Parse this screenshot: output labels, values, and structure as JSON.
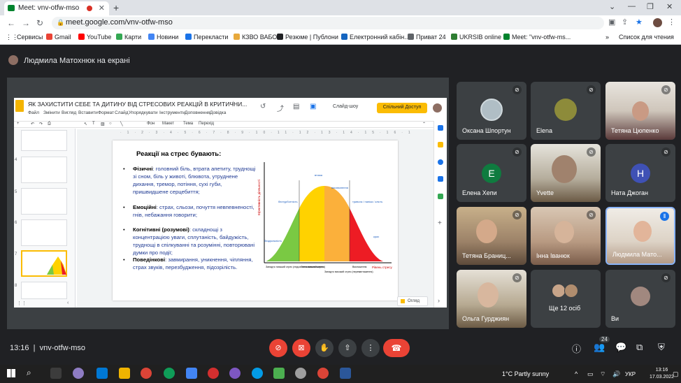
{
  "browser": {
    "tab_title": "Meet: vnv-otfw-mso",
    "url": "meet.google.com/vnv-otfw-mso",
    "bookmarks": [
      "Сервисы",
      "Gmail",
      "YouTube",
      "Карти",
      "Новини",
      "Перекласти",
      "КЗВО ВАБО",
      "Резюме | Публони",
      "Електронний кабін...",
      "Приват 24",
      "UKRSIB online",
      "Meet: \"vnv-otfw-ms..."
    ],
    "reading_list": "Список для чтения",
    "bookmark_colors": [
      "#4285f4",
      "#ea4335",
      "#ff0000",
      "#34a853",
      "#4285f4",
      "#1a73e8",
      "#e8a93c",
      "#202124",
      "#1565c0",
      "#5f6368",
      "#2e7d32",
      "#00832d"
    ]
  },
  "meet": {
    "presenter_banner": "Людмила Матохнюк на екрані",
    "meeting_time": "13:16",
    "meeting_code": "vnv-otfw-mso",
    "participants_badge": "24",
    "participants": [
      {
        "name": "Оксана Шпортун",
        "kind": "photo",
        "muted": true
      },
      {
        "name": "Elena",
        "kind": "photo",
        "muted": true
      },
      {
        "name": "Тетяна Цюпенко",
        "kind": "video",
        "muted": true
      },
      {
        "name": "Елена Хепи",
        "kind": "initial",
        "initial": "E",
        "color": "#0f7b3f",
        "muted": true
      },
      {
        "name": "Yvette",
        "kind": "video",
        "muted": true
      },
      {
        "name": "Ната Джоган",
        "kind": "initial",
        "initial": "H",
        "color": "#3f51b5",
        "muted": true
      },
      {
        "name": "Тетяна Браниц...",
        "kind": "video",
        "muted": true
      },
      {
        "name": "Інна Іванюк",
        "kind": "video",
        "muted": true
      },
      {
        "name": "Людмила Мато...",
        "kind": "video",
        "muted": false
      },
      {
        "name": "Ольга Гурджиян",
        "kind": "video",
        "muted": true
      },
      {
        "name": "Ще 12 осіб",
        "kind": "more",
        "muted": false
      },
      {
        "name": "Ви",
        "kind": "photo",
        "muted": true
      }
    ]
  },
  "slides": {
    "doc_title": "ЯК ЗАХИСТИТИ СЕБЕ ТА ДИТИНУ ВІД СТРЕСОВИХ РЕАКЦІЙ В КРИТИЧНИ...",
    "menu": [
      "Файл",
      "Змінити",
      "Вигляд",
      "Вставити",
      "Формат",
      "Слайд",
      "Упорядкувати",
      "Інструменти",
      "Доповнення",
      "Довідка"
    ],
    "share": "Спільний Доступ",
    "slideshow": "Слайд-шоу",
    "toolbar": [
      "Фон",
      "Макет",
      "Тема",
      "Перехід"
    ],
    "thumb_numbers": [
      "4",
      "5",
      "6",
      "7",
      "8"
    ],
    "notes_hint": "Огляд",
    "slide_title": "Реакції на стрес бувають:",
    "bullets": [
      {
        "head": "Фізичні",
        "text": ": головний біль, втрата апетиту, труднощі зі сном, біль у животі, блювота, утруднене дихання, тремор, потіння, сухі губи, пришвидшене серцебиття;"
      },
      {
        "head": "Емоційні",
        "text": ": страх, сльози, почуття невпевненості, гнів, небажання говорити;"
      },
      {
        "head": "Когнітивні (розумові)",
        "text": ": складнощі з концентрацією уваги, сплутаність, байдужість, труднощі в спілкуванні та розумінні, повторювані думки про події;"
      },
      {
        "head": "Поведінкові",
        "text": ": завмирання, уникнення, чіпляння, страх звуків, перезбудження, підозрілість."
      }
    ],
    "chart": {
      "y_label": "Ефективність діяльності",
      "x_label": "Рівень стресу",
      "peak_label": "втома",
      "labels": [
        "бездіяльність",
        "безтурботність",
        "висхвилення",
        "тривога / паніка / злість",
        "крах"
      ],
      "zones": [
        "Занадто низький стрес (недостатнє навантаження)",
        "Оптимальний стрес",
        "Занадто високий стрес (перевантаження)",
        "Виснаження"
      ],
      "zone_colors": [
        "#7ac943",
        "#ffd200",
        "#fbb03b",
        "#ed1c24"
      ]
    }
  },
  "taskbar": {
    "weather": "1°C  Partly sunny",
    "lang": "УКР",
    "time": "13:16",
    "date": "17.03.2022",
    "app_colors": [
      "#3c3c3c",
      "#8e7cc3",
      "#0078d4",
      "#f0b400",
      "#db4437",
      "#0f9d58",
      "#4285f4",
      "#d32f2f",
      "#7e57c2",
      "#039be5",
      "#4caf50",
      "#9e9e9e",
      "#db4437",
      "#2b579a"
    ]
  }
}
